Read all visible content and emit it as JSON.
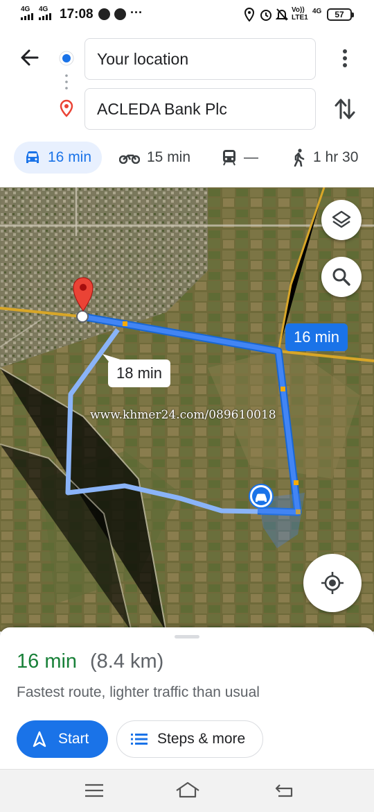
{
  "status_bar": {
    "signal_1": "4G",
    "signal_2": "4G",
    "time": "17:08",
    "more": "···",
    "volte": "Vo))\nLTE1",
    "net": "4G",
    "battery": "57"
  },
  "directions": {
    "origin": "Your location",
    "destination": "ACLEDA Bank Plc"
  },
  "modes": [
    {
      "name": "drive",
      "label": "16 min",
      "icon": "car-icon"
    },
    {
      "name": "motorcycle",
      "label": "15 min",
      "icon": "motorcycle-icon"
    },
    {
      "name": "transit",
      "label": "—",
      "icon": "train-icon"
    },
    {
      "name": "walk",
      "label": "1 hr 30",
      "icon": "walking-icon"
    }
  ],
  "map": {
    "main_route_time": "16 min",
    "alt_route_time": "18 min",
    "watermark": "www.khmer24.com/089610018",
    "route_color": "#1a73e8",
    "alt_route_color": "#8ab4f8"
  },
  "summary": {
    "duration": "16 min",
    "distance": "(8.4 km)",
    "description": "Fastest route, lighter traffic than usual",
    "start_label": "Start",
    "steps_label": "Steps & more"
  },
  "colors": {
    "accent": "#1a73e8",
    "duration_green": "#188038",
    "pin_red": "#ea4335"
  }
}
